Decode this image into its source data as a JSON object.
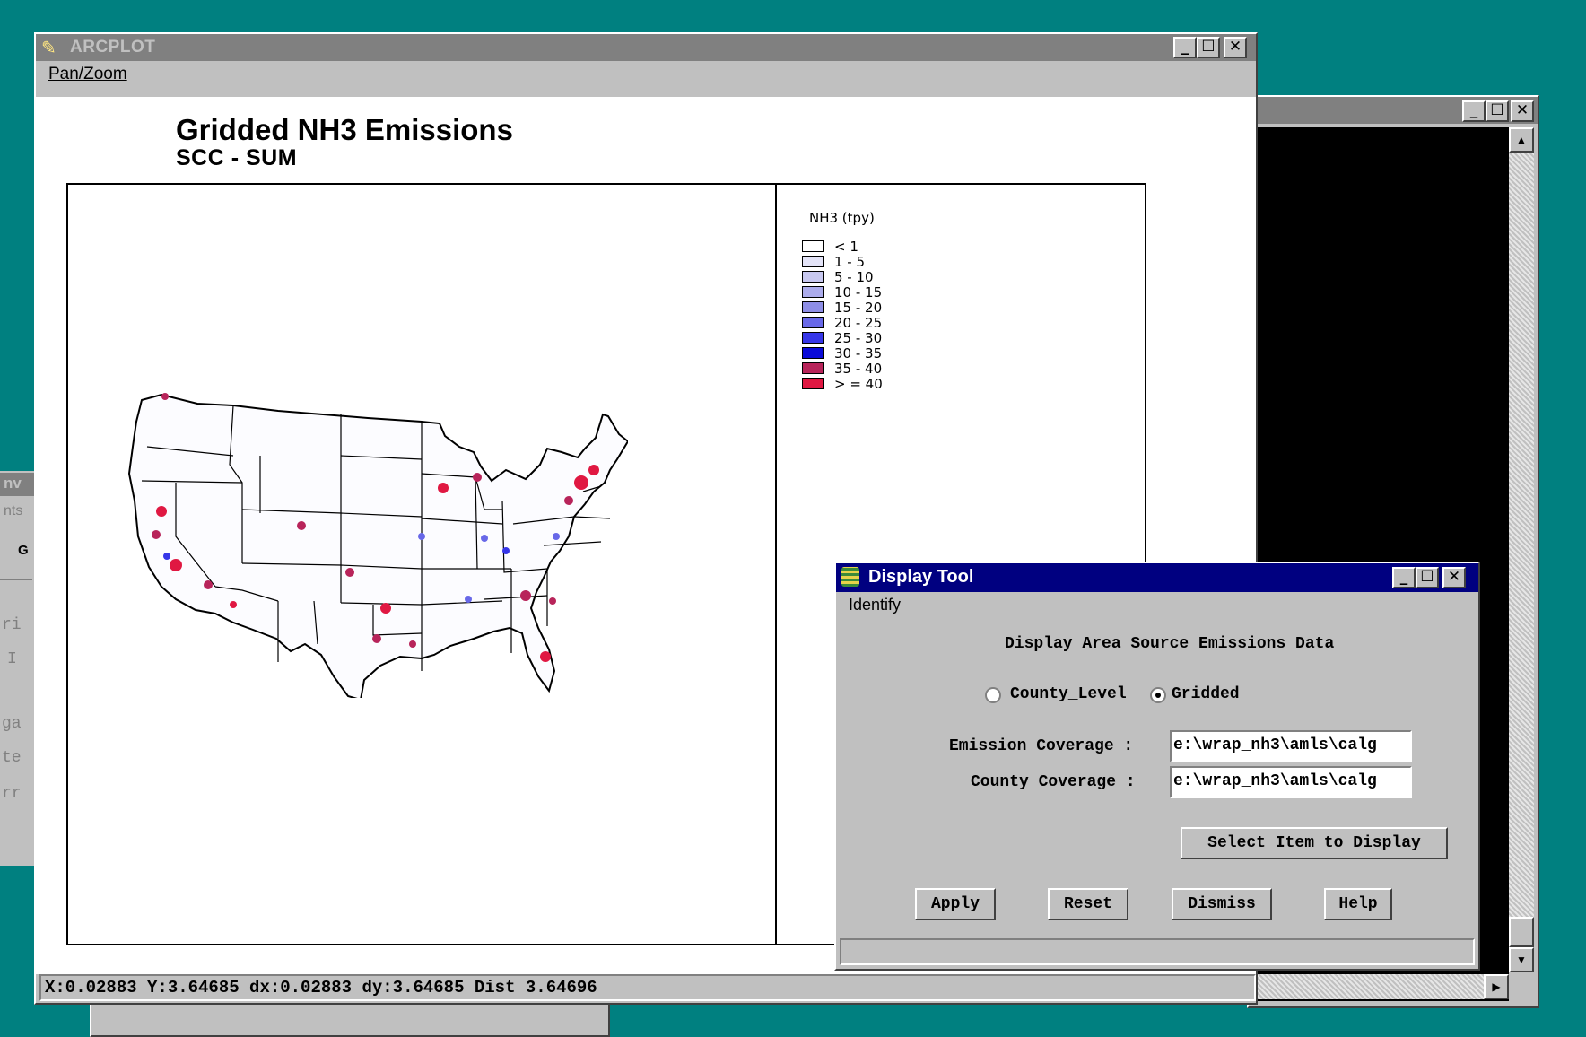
{
  "arcplot": {
    "title": "ARCPLOT",
    "menu": [
      "Pan/Zoom"
    ],
    "map_title": "Gridded NH3 Emissions",
    "map_subtitle": "SCC - SUM",
    "status": "X:0.02883 Y:3.64685 dx:0.02883 dy:3.64685 Dist 3.64696"
  },
  "legend": {
    "title": "NH3 (tpy)",
    "items": [
      {
        "label": "< 1",
        "color": "#ffffff"
      },
      {
        "label": "1 - 5",
        "color": "#e4e4f8"
      },
      {
        "label": "5 - 10",
        "color": "#c8c8f0"
      },
      {
        "label": "10 - 15",
        "color": "#acacec"
      },
      {
        "label": "15 - 20",
        "color": "#8e8ee6"
      },
      {
        "label": "20 - 25",
        "color": "#6868e8"
      },
      {
        "label": "25 - 30",
        "color": "#3636e8"
      },
      {
        "label": "30 - 35",
        "color": "#0a0ad8"
      },
      {
        "label": "35 - 40",
        "color": "#b8245a"
      },
      {
        "label": "> = 40",
        "color": "#e01842"
      }
    ]
  },
  "display_tool": {
    "title": "Display Tool",
    "menu": [
      "Identify"
    ],
    "heading": "Display Area Source Emissions Data",
    "radio_options": [
      {
        "label": "County_Level",
        "selected": false
      },
      {
        "label": "Gridded",
        "selected": true
      }
    ],
    "emission_label": "Emission Coverage :",
    "emission_value": "e:\\wrap_nh3\\amls\\calg",
    "county_label": "County Coverage :",
    "county_value": "e:\\wrap_nh3\\amls\\calg",
    "select_button": "Select Item to Display",
    "buttons": [
      "Apply",
      "Reset",
      "Dismiss",
      "Help"
    ]
  },
  "background_window": {
    "left_partial_labels": [
      "nv",
      "nts",
      "G",
      "ri",
      "I",
      "ga",
      "te",
      "rr"
    ]
  },
  "colors": {
    "desktop": "#008080",
    "active_titlebar": "#000080",
    "inactive_titlebar": "#808080"
  }
}
